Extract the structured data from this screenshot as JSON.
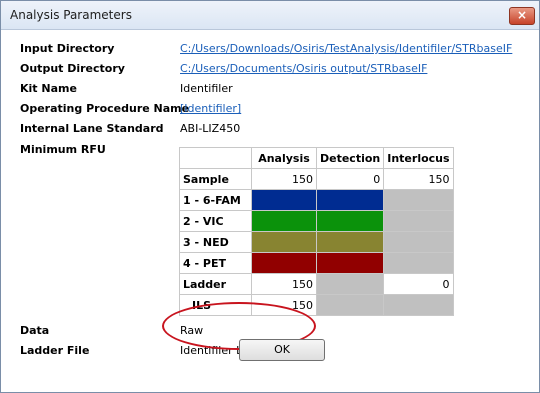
{
  "window": {
    "title": "Analysis Parameters",
    "close_glyph": "×"
  },
  "fields": {
    "input_dir_label": "Input Directory",
    "input_dir_value": "C:/Users/Downloads/Osiris/TestAnalysis/Identifiler/STRbaseIF",
    "output_dir_label": "Output Directory",
    "output_dir_value": "C:/Users/Documents/Osiris output/STRbaseIF",
    "kit_label": "Kit Name",
    "kit_value": "Identifiler",
    "procedure_label": "Operating Procedure Name",
    "procedure_value": "[Identifiler]",
    "ils_label": "Internal Lane Standard",
    "ils_value": "ABI-LIZ450",
    "rfu_label": "Minimum RFU",
    "data_label": "Data",
    "data_value": "Raw",
    "ladder_label": "Ladder File",
    "ladder_value": "Identifiler LADDER.fsa"
  },
  "rfu_table": {
    "headers": [
      "Analysis",
      "Detection",
      "Interlocus"
    ],
    "rows": {
      "sample": {
        "label": "Sample",
        "analysis": "150",
        "detection": "0",
        "interlocus": "150"
      },
      "fam": {
        "label": "1 - 6-FAM",
        "color": "#002c91"
      },
      "vic": {
        "label": "2 - VIC",
        "color": "#0b920b"
      },
      "ned": {
        "label": "3 - NED",
        "color": "#888431"
      },
      "pet": {
        "label": "4 - PET",
        "color": "#910000"
      },
      "ladder": {
        "label": "Ladder",
        "analysis": "150",
        "interlocus": "0"
      },
      "ils": {
        "label": "ILS",
        "analysis": "150"
      }
    }
  },
  "buttons": {
    "ok_label": "OK"
  }
}
